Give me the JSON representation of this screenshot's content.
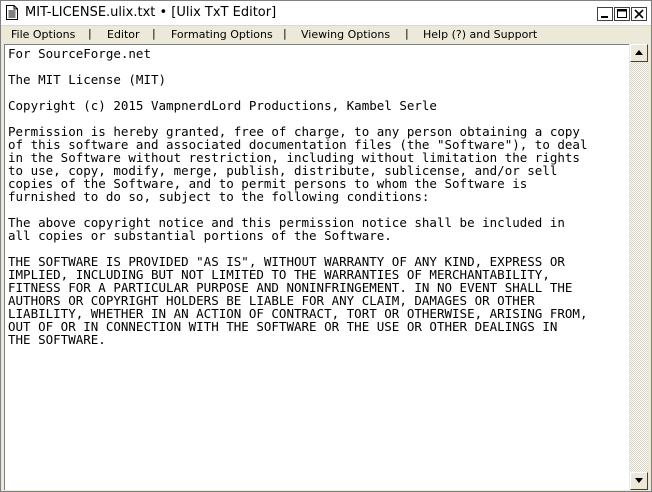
{
  "window": {
    "title": "MIT-LICENSE.ulix.txt • [Ulix TxT Editor]"
  },
  "controls": {
    "minimize_icon": "minimize-icon",
    "maximize_icon": "maximize-icon",
    "close_icon": "close-icon"
  },
  "menu": {
    "items": [
      {
        "label": "File Options"
      },
      {
        "label": "Editor"
      },
      {
        "label": "Formating Options"
      },
      {
        "label": "Viewing Options"
      },
      {
        "label": "Help (?) and Support"
      }
    ],
    "separator": "|"
  },
  "editor": {
    "content": "For SourceForge.net\n\nThe MIT License (MIT)\n\nCopyright (c) 2015 VampnerdLord Productions, Kambel Serle\n\nPermission is hereby granted, free of charge, to any person obtaining a copy\nof this software and associated documentation files (the \"Software\"), to deal\nin the Software without restriction, including without limitation the rights\nto use, copy, modify, merge, publish, distribute, sublicense, and/or sell\ncopies of the Software, and to permit persons to whom the Software is\nfurnished to do so, subject to the following conditions:\n\nThe above copyright notice and this permission notice shall be included in\nall copies or substantial portions of the Software.\n\nTHE SOFTWARE IS PROVIDED \"AS IS\", WITHOUT WARRANTY OF ANY KIND, EXPRESS OR\nIMPLIED, INCLUDING BUT NOT LIMITED TO THE WARRANTIES OF MERCHANTABILITY,\nFITNESS FOR A PARTICULAR PURPOSE AND NONINFRINGEMENT. IN NO EVENT SHALL THE\nAUTHORS OR COPYRIGHT HOLDERS BE LIABLE FOR ANY CLAIM, DAMAGES OR OTHER\nLIABILITY, WHETHER IN AN ACTION OF CONTRACT, TORT OR OTHERWISE, ARISING FROM,\nOUT OF OR IN CONNECTION WITH THE SOFTWARE OR THE USE OR OTHER DEALINGS IN\nTHE SOFTWARE."
  },
  "scrollbar": {
    "up_icon": "scroll-up-arrow-icon",
    "down_icon": "scroll-down-arrow-icon"
  }
}
